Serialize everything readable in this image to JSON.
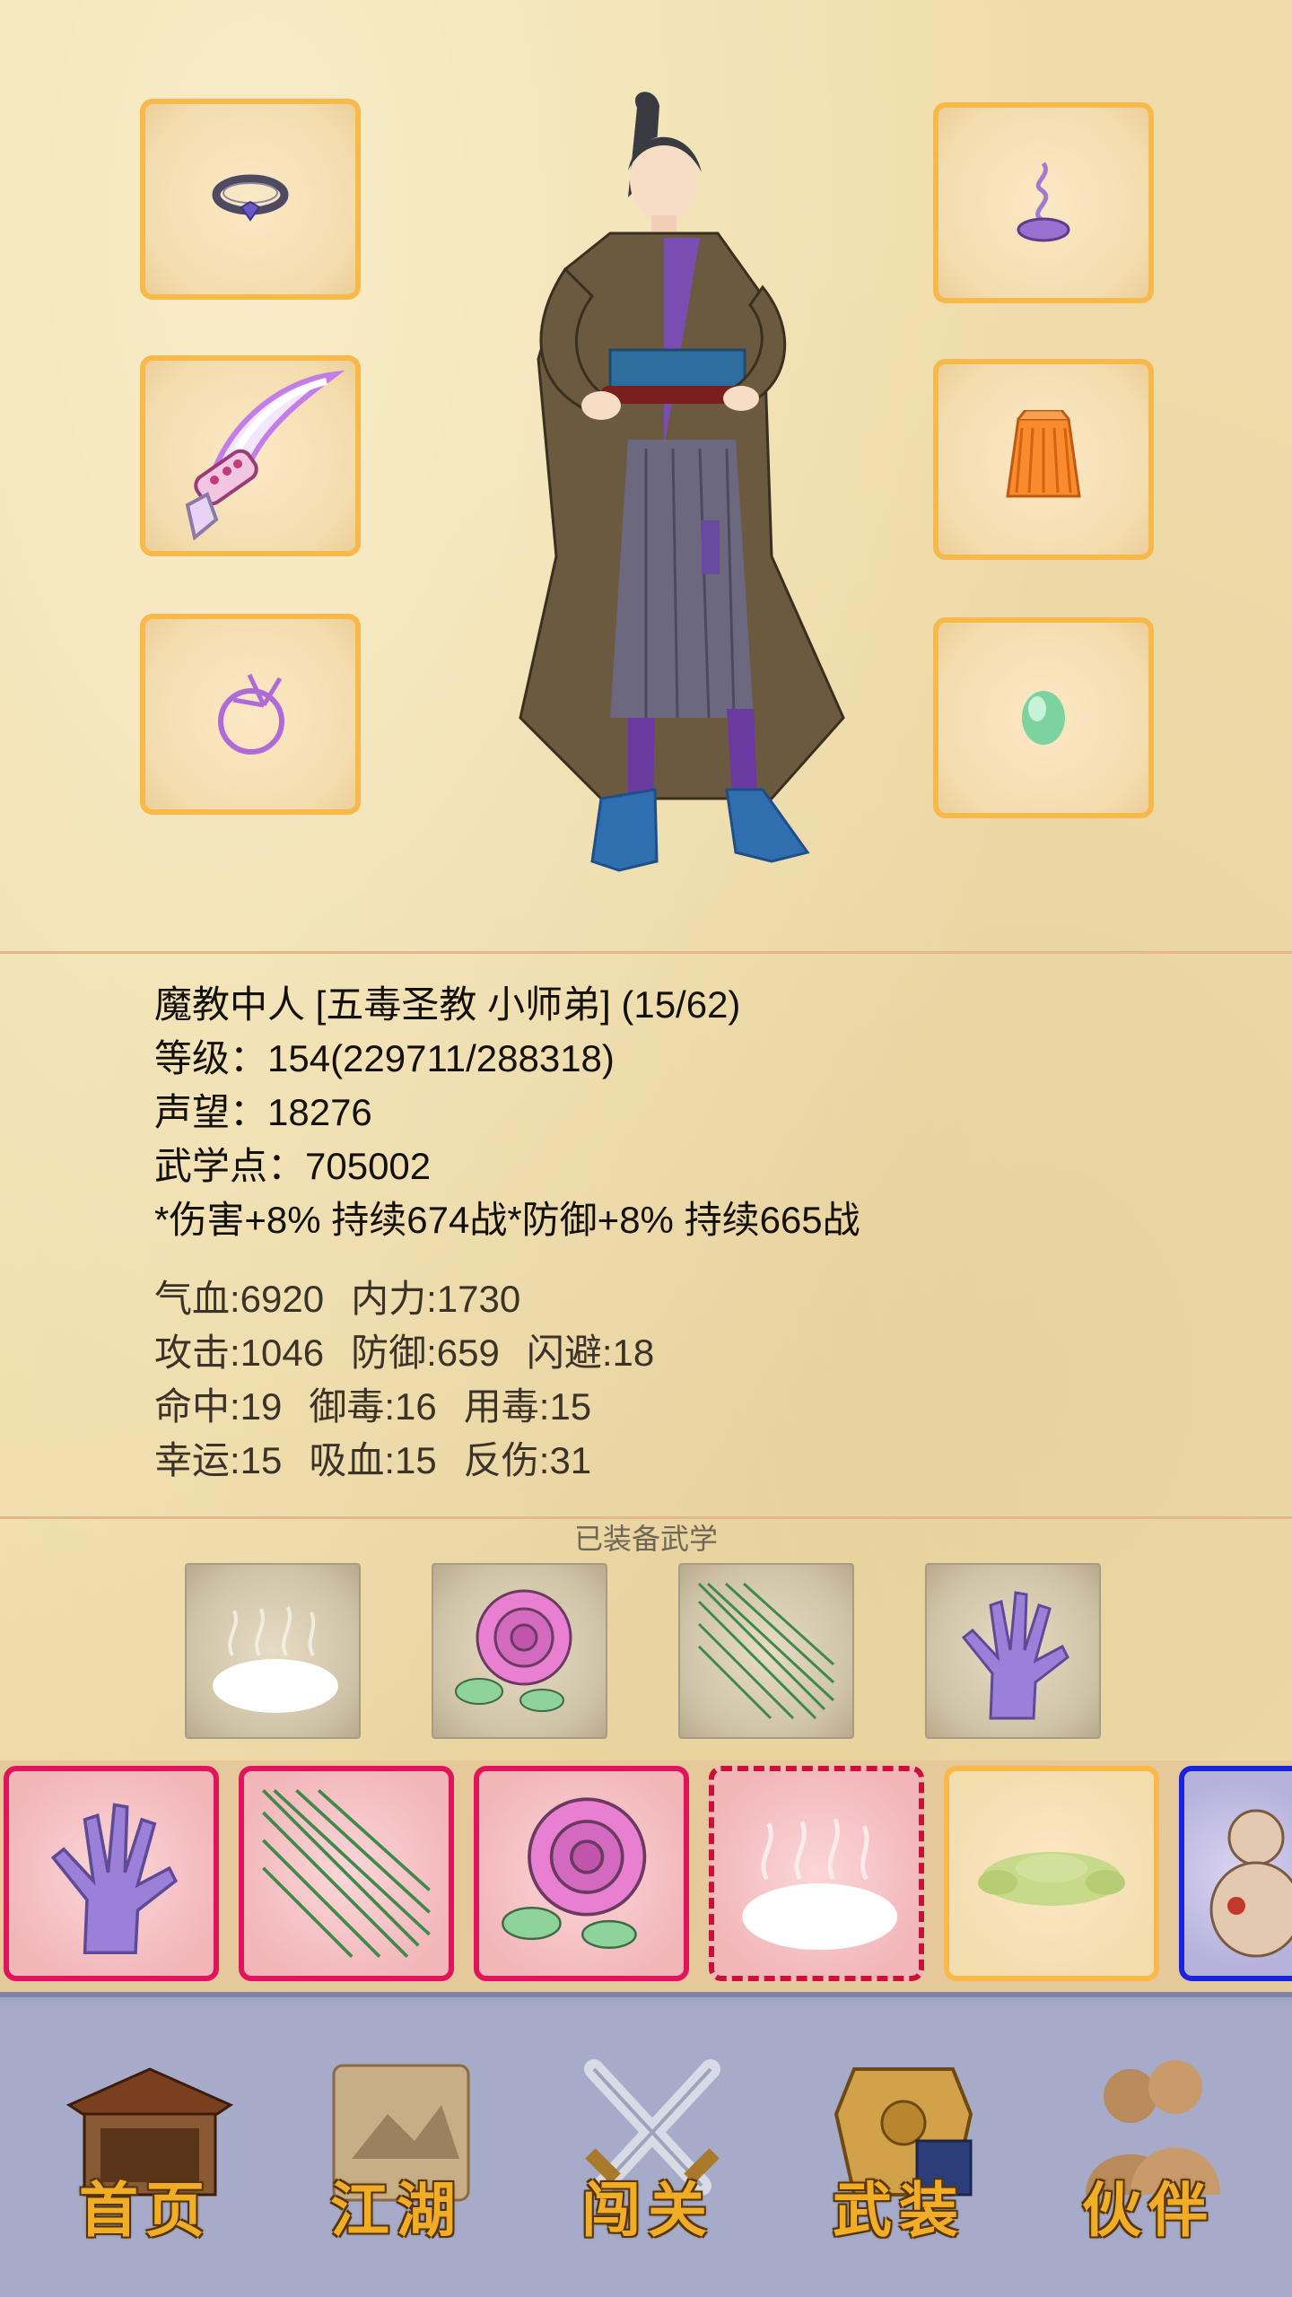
{
  "character": {
    "title_line": "魔教中人 [五毒圣教 小师弟] (15/62)",
    "level_line": "等级：154(229711/288318)",
    "reputation_line": "声望：18276",
    "martial_points_line": "武学点：705002",
    "buffs_line": "*伤害+8% 持续674战*防御+8% 持续665战"
  },
  "stats": {
    "hp": "气血:6920",
    "mp": "内力:1730",
    "attack": "攻击:1046",
    "defense": "防御:659",
    "dodge": "闪避:18",
    "hit": "命中:19",
    "poison_resist": "御毒:16",
    "poison_use": "用毒:15",
    "luck": "幸运:15",
    "lifesteal": "吸血:15",
    "reflect": "反伤:31"
  },
  "equipped_skills": {
    "title": "已装备武学",
    "items": [
      "mist-skill-icon",
      "rose-skill-icon",
      "needles-skill-icon",
      "palm-skill-icon"
    ]
  },
  "skill_tray": {
    "items": [
      "palm-skill-icon",
      "needles-skill-icon",
      "rose-skill-icon",
      "mist-skill-icon",
      "green-toad-skill-icon",
      "gourd-skill-icon"
    ]
  },
  "equipment": {
    "left": [
      "ring-icon",
      "curved-dagger-icon",
      "bracelet-icon"
    ],
    "right": [
      "incense-icon",
      "orange-robe-icon",
      "jade-bead-icon"
    ]
  },
  "nav": {
    "home": "首页",
    "jianghu": "江湖",
    "chuangguan": "闯关",
    "wuzhuang": "武装",
    "huoban": "伙伴"
  },
  "colors": {
    "slot_border": "#f8b84a",
    "card_border_red": "#e2135a",
    "card_border_gold": "#f8b84a",
    "card_border_blue": "#1a24e0",
    "nav_bg": "#a7abca",
    "nav_label": "#f1ad26"
  }
}
